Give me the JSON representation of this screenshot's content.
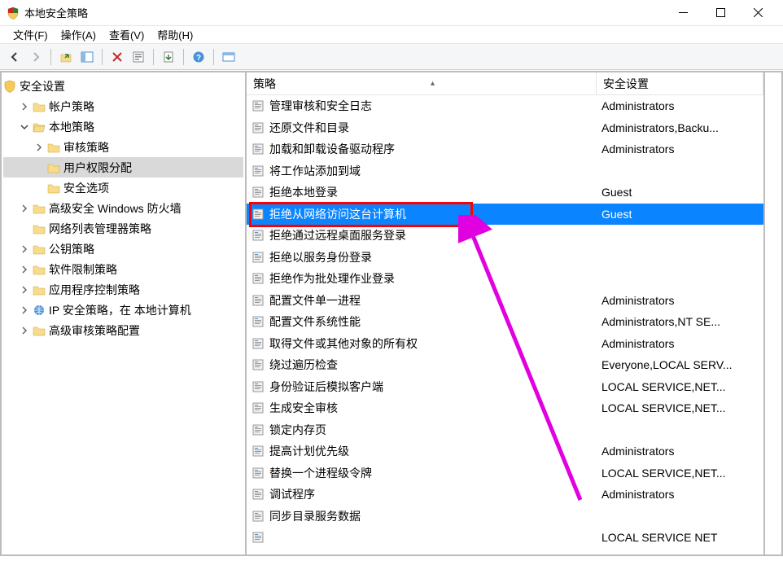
{
  "window": {
    "title": "本地安全策略"
  },
  "menu": {
    "file": "文件(F)",
    "action": "操作(A)",
    "view": "查看(V)",
    "help": "帮助(H)"
  },
  "tree": {
    "root": "安全设置",
    "items": [
      {
        "label": "帐户策略",
        "depth": 1,
        "expander": ">",
        "icon": "folder"
      },
      {
        "label": "本地策略",
        "depth": 1,
        "expander": "v",
        "icon": "folder-open"
      },
      {
        "label": "审核策略",
        "depth": 2,
        "expander": ">",
        "icon": "folder"
      },
      {
        "label": "用户权限分配",
        "depth": 2,
        "expander": "",
        "icon": "folder",
        "selected": true
      },
      {
        "label": "安全选项",
        "depth": 2,
        "expander": "",
        "icon": "folder"
      },
      {
        "label": "高级安全 Windows 防火墙",
        "depth": 1,
        "expander": ">",
        "icon": "folder"
      },
      {
        "label": "网络列表管理器策略",
        "depth": 1,
        "expander": "",
        "icon": "folder"
      },
      {
        "label": "公钥策略",
        "depth": 1,
        "expander": ">",
        "icon": "folder"
      },
      {
        "label": "软件限制策略",
        "depth": 1,
        "expander": ">",
        "icon": "folder"
      },
      {
        "label": "应用程序控制策略",
        "depth": 1,
        "expander": ">",
        "icon": "folder"
      },
      {
        "label": "IP 安全策略，在 本地计算机",
        "depth": 1,
        "expander": ">",
        "icon": "ip"
      },
      {
        "label": "高级审核策略配置",
        "depth": 1,
        "expander": ">",
        "icon": "folder"
      }
    ]
  },
  "list": {
    "header_policy": "策略",
    "header_setting": "安全设置",
    "rows": [
      {
        "policy": "管理审核和安全日志",
        "setting": "Administrators"
      },
      {
        "policy": "还原文件和目录",
        "setting": "Administrators,Backu..."
      },
      {
        "policy": "加载和卸载设备驱动程序",
        "setting": "Administrators"
      },
      {
        "policy": "将工作站添加到域",
        "setting": ""
      },
      {
        "policy": "拒绝本地登录",
        "setting": "Guest"
      },
      {
        "policy": "拒绝从网络访问这台计算机",
        "setting": "Guest",
        "selected": true
      },
      {
        "policy": "拒绝通过远程桌面服务登录",
        "setting": ""
      },
      {
        "policy": "拒绝以服务身份登录",
        "setting": ""
      },
      {
        "policy": "拒绝作为批处理作业登录",
        "setting": ""
      },
      {
        "policy": "配置文件单一进程",
        "setting": "Administrators"
      },
      {
        "policy": "配置文件系统性能",
        "setting": "Administrators,NT SE..."
      },
      {
        "policy": "取得文件或其他对象的所有权",
        "setting": "Administrators"
      },
      {
        "policy": "绕过遍历检查",
        "setting": "Everyone,LOCAL SERV..."
      },
      {
        "policy": "身份验证后模拟客户端",
        "setting": "LOCAL SERVICE,NET..."
      },
      {
        "policy": "生成安全审核",
        "setting": "LOCAL SERVICE,NET..."
      },
      {
        "policy": "锁定内存页",
        "setting": ""
      },
      {
        "policy": "提高计划优先级",
        "setting": "Administrators"
      },
      {
        "policy": "替换一个进程级令牌",
        "setting": "LOCAL SERVICE,NET..."
      },
      {
        "policy": "调试程序",
        "setting": "Administrators"
      },
      {
        "policy": "同步目录服务数据",
        "setting": ""
      },
      {
        "policy": "",
        "setting": "LOCAL SERVICE NET"
      }
    ]
  }
}
